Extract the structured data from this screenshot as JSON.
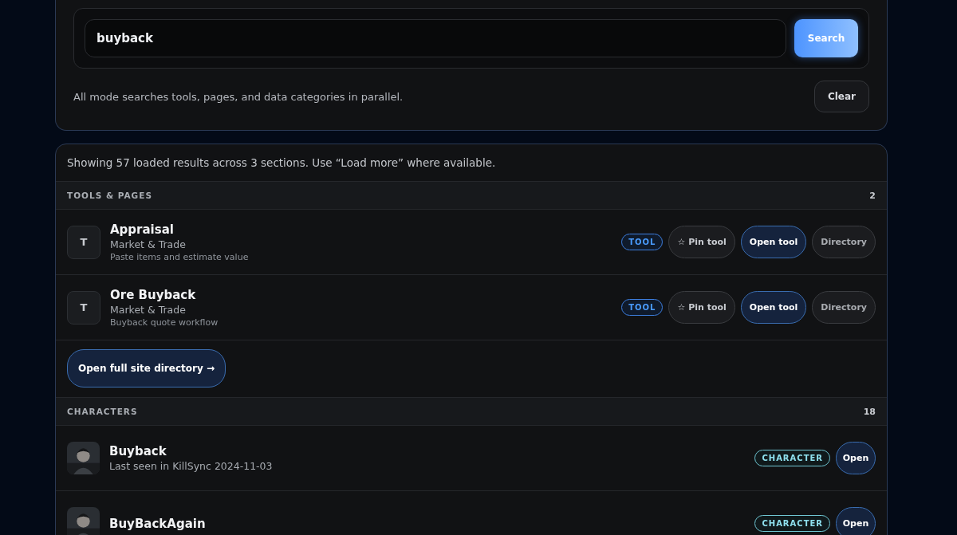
{
  "search": {
    "value": "buyback",
    "button": "Search",
    "hint": "All mode searches tools, pages, and data categories in parallel.",
    "clear": "Clear"
  },
  "results": {
    "summary": "Showing 57 loaded results across 3 sections. Use “Load more” where available.",
    "sections": [
      {
        "kind": "tools",
        "title": "TOOLS & PAGES",
        "count": "2",
        "items": [
          {
            "initial": "T",
            "title": "Appraisal",
            "category": "Market & Trade",
            "description": "Paste items and estimate value",
            "tag": "TOOL",
            "pin": "☆ Pin tool",
            "open": "Open tool",
            "directory": "Directory"
          },
          {
            "initial": "T",
            "title": "Ore Buyback",
            "category": "Market & Trade",
            "description": "Buyback quote workflow",
            "tag": "TOOL",
            "pin": "☆ Pin tool",
            "open": "Open tool",
            "directory": "Directory"
          }
        ],
        "footer_link": "Open full site directory →"
      },
      {
        "kind": "characters",
        "title": "CHARACTERS",
        "count": "18",
        "items": [
          {
            "kind": "picture",
            "name": "Buyback",
            "subtitle": "Last seen in KillSync 2024-11-03",
            "tag": "CHARACTER",
            "open": "Open"
          },
          {
            "kind": "picture",
            "name": "BuyBackAgain",
            "tag": "CHARACTER",
            "open": "Open"
          }
        ]
      }
    ]
  }
}
